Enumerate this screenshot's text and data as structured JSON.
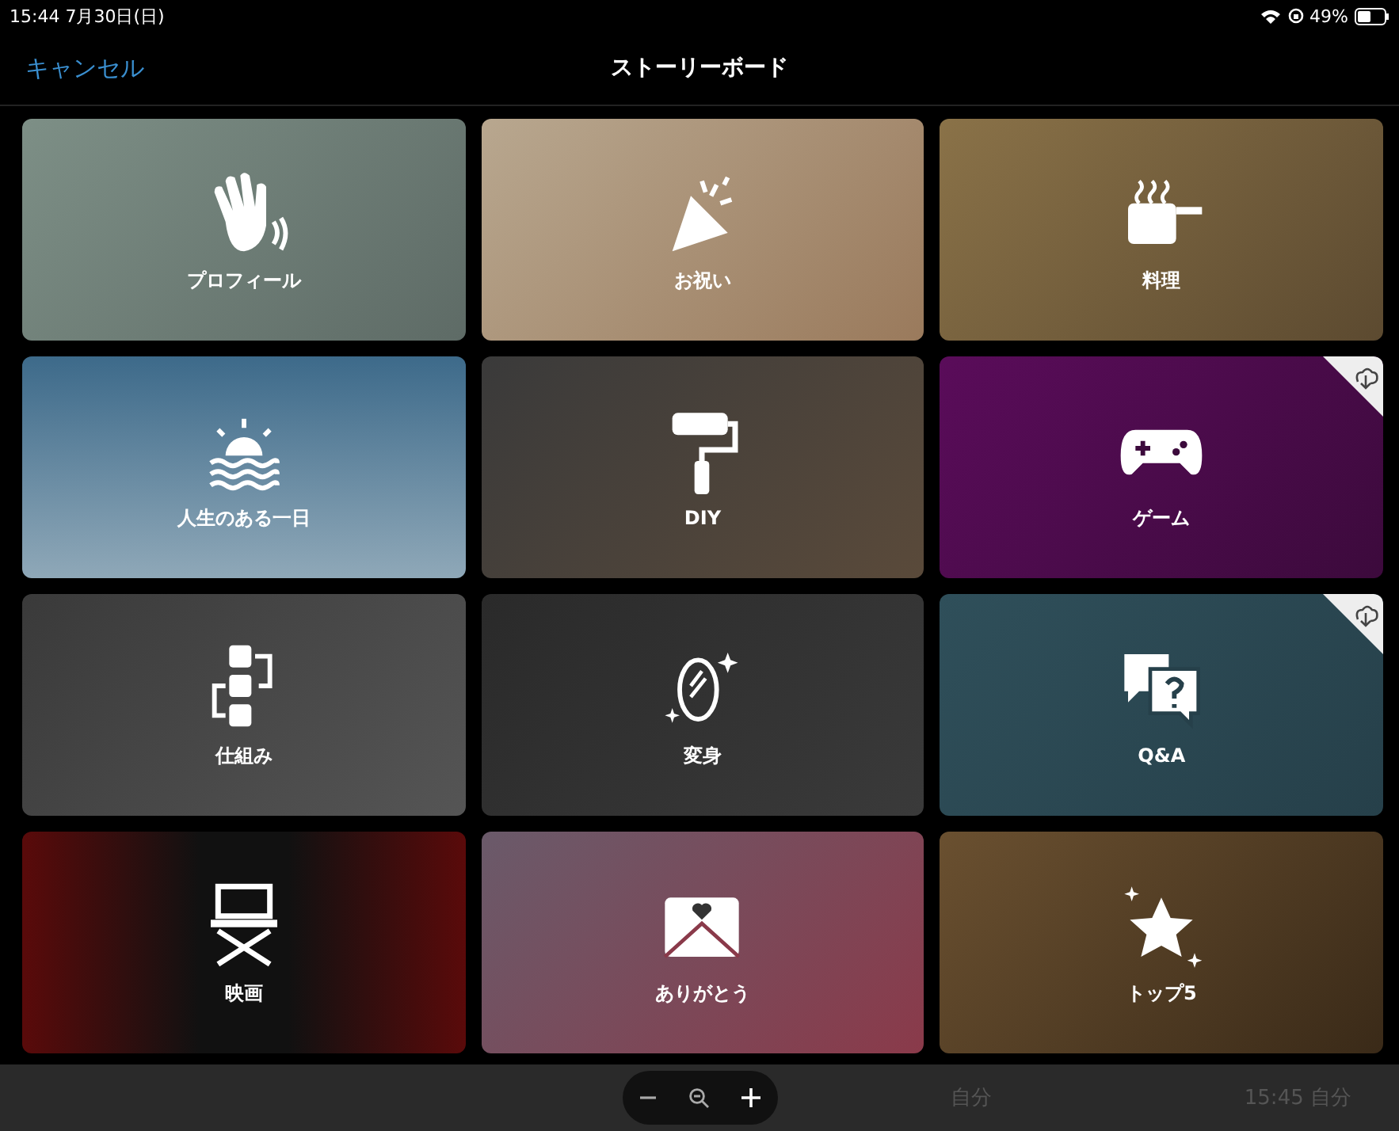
{
  "status_bar": {
    "time": "15:44  7月30日(日)",
    "battery": "49%"
  },
  "nav": {
    "cancel": "キャンセル",
    "title": "ストーリーボード"
  },
  "tiles": [
    {
      "label": "プロフィール",
      "kind": "hand",
      "download": false
    },
    {
      "label": "お祝い",
      "kind": "party",
      "download": false
    },
    {
      "label": "料理",
      "kind": "pot",
      "download": false
    },
    {
      "label": "人生のある一日",
      "kind": "sunrise",
      "download": false
    },
    {
      "label": "DIY",
      "kind": "roller",
      "download": false
    },
    {
      "label": "ゲーム",
      "kind": "gamepad",
      "download": true
    },
    {
      "label": "仕組み",
      "kind": "flow",
      "download": false
    },
    {
      "label": "変身",
      "kind": "mirror",
      "download": false
    },
    {
      "label": "Q&A",
      "kind": "qa",
      "download": true
    },
    {
      "label": "映画",
      "kind": "chair",
      "download": false
    },
    {
      "label": "ありがとう",
      "kind": "envelope",
      "download": false
    },
    {
      "label": "トップ5",
      "kind": "star",
      "download": false
    }
  ],
  "bottom_bar": {
    "left": "自分",
    "right": "15:45 自分"
  }
}
